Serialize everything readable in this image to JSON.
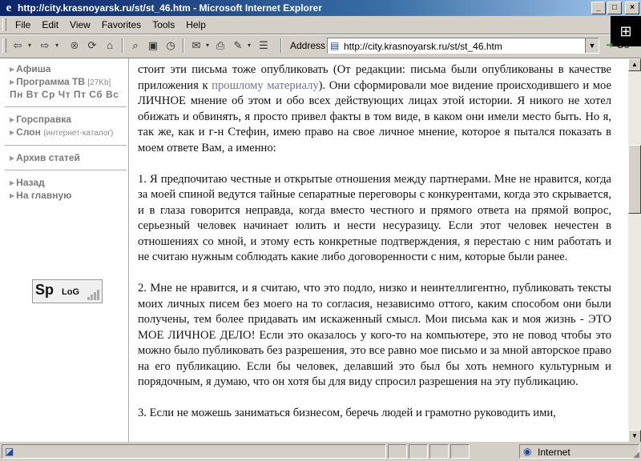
{
  "window": {
    "title": "http://city.krasnoyarsk.ru/st/st_46.htm - Microsoft Internet Explorer",
    "minimize": "_",
    "maximize": "□",
    "close": "×"
  },
  "menu": {
    "items": [
      "File",
      "Edit",
      "View",
      "Favorites",
      "Tools",
      "Help"
    ]
  },
  "toolbar": {
    "address_label": "Address",
    "url": "http://city.krasnoyarsk.ru/st/st_46.htm",
    "go_label": "Go"
  },
  "sidebar": {
    "items_top": [
      {
        "label": "Афиша"
      },
      {
        "label": "Программа ТВ",
        "note": "[27Kb]"
      }
    ],
    "days": "Пн Вт Ср Чт Пт Сб Вс",
    "items_mid": [
      {
        "label": "Горсправка"
      },
      {
        "label": "Слон",
        "note": "(интернет-каталог)"
      }
    ],
    "archive": "Архив статей",
    "items_bottom": [
      {
        "label": "Назад"
      },
      {
        "label": "На главную"
      }
    ],
    "splog": {
      "text1": "Sp",
      "text2": "LoG"
    }
  },
  "article": {
    "p1_a": "стоит эти письма тоже опубликовать (От редакции: письма были опубликованы в качестве приложения к ",
    "p1_link": "прошлому материалу",
    "p1_b": "). Они сформировали мое видение происходившего и мое ЛИЧНОЕ мнение об этом и обо всех действующих лицах этой истории. Я никого не хотел обижать и обвинять, я просто привел факты в том виде, в каком они имели место быть. Но я, так же, как и г-н Стефин, имею право на свое личное мнение, которое я пытался показать в моем ответе Вам, а именно:",
    "p2": "1. Я предпочитаю честные и открытые отношения между партнерами. Мне не нравится, когда за моей спиной ведутся тайные сепаратные переговоры с конкурентами, когда это скрывается, и в глаза говорится неправда, когда вместо честного и прямого ответа на прямой вопрос, серьезный человек начинает юлить и нести несуразицу. Если этот человек нечестен в отношениях со мной, и этому есть конкретные подтверждения, я перестаю с ним работать и не считаю нужным соблюдать какие либо договоренности с ним, которые были ранее.",
    "p3": "2. Мне не нравится, и я считаю, что это подло, низко и неинтеллигентно, публиковать тексты моих личных писем без моего на то согласия, независимо оттого, каким способом они были получены, тем более придавать им искаженный смысл. Мои письма как и моя жизнь - ЭТО МОЕ ЛИЧНОЕ ДЕЛО! Если это оказалось у кого-то на компьютере, это не повод чтобы это можно было публиковать без разрешения, это все равно мое письмо и за мной авторское право на его публикацию. Если бы человек, делавший это был бы хоть немного культурным и порядочным, я думаю, что он хотя бы для виду спросил разрешения на эту публикацию.",
    "p4": "3. Если не можешь заниматься бизнесом, беречь людей и грамотно руководить ими,"
  },
  "status": {
    "zone": "Internet"
  },
  "icons": {
    "back": "back-arrow-icon",
    "forward": "forward-arrow-icon",
    "stop": "stop-icon",
    "refresh": "refresh-icon",
    "home": "home-icon",
    "search": "search-icon",
    "favorites": "favorites-icon",
    "history": "history-icon",
    "mail": "mail-icon",
    "print": "print-icon",
    "edit": "edit-icon",
    "discuss": "discuss-icon"
  }
}
